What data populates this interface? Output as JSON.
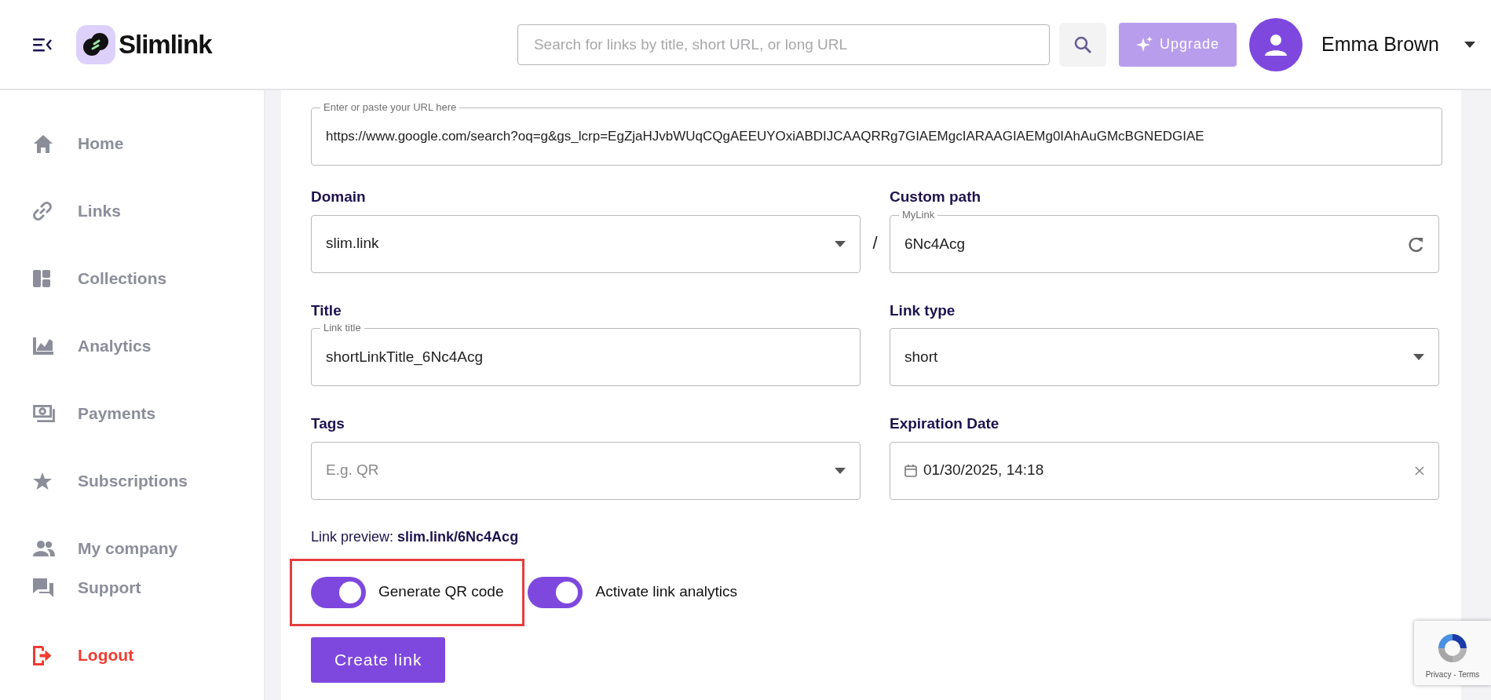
{
  "header": {
    "brand": "Slimlink",
    "search": {
      "placeholder": "Search for links by title, short URL, or long URL"
    },
    "upgrade_button": "Upgrade",
    "user": {
      "name": "Emma Brown"
    }
  },
  "sidebar": {
    "items": [
      {
        "label": "Home",
        "kind": "nav"
      },
      {
        "label": "Links",
        "kind": "nav"
      },
      {
        "label": "Collections",
        "kind": "nav"
      },
      {
        "label": "Analytics",
        "kind": "nav"
      },
      {
        "label": "Payments",
        "kind": "nav"
      },
      {
        "label": "Subscriptions",
        "kind": "nav"
      },
      {
        "label": "My company",
        "kind": "nav"
      }
    ],
    "bottom_items": [
      {
        "label": "Support",
        "kind": "nav"
      },
      {
        "label": "Logout",
        "kind": "logout"
      }
    ]
  },
  "form": {
    "url": {
      "legend": "Enter or paste your URL here",
      "value": "https://www.google.com/search?oq=g&gs_lcrp=EgZjaHJvbWUqCQgAEEUYOxiABDIJCAAQRRg7GIAEMgcIARAAGIAEMg0IAhAuGMcBGNEDGIAE"
    },
    "path_separator": "/",
    "rows": [
      [
        {
          "label": "Domain",
          "kind": "select",
          "value": "slim.link"
        },
        {
          "label": "Custom path",
          "kind": "text",
          "legend": "MyLink",
          "value": "6Nc4Acg"
        }
      ],
      [
        {
          "label": "Title",
          "kind": "text_plain",
          "legend": "Link title",
          "value": "shortLinkTitle_6Nc4Acg"
        },
        {
          "label": "Link type",
          "kind": "select",
          "value": "short"
        }
      ],
      [
        {
          "label": "Tags",
          "kind": "select",
          "placeholder": "E.g. QR"
        },
        {
          "label": "Expiration Date",
          "kind": "date",
          "value": "01/30/2025, 14:18"
        }
      ]
    ],
    "link_preview": "Link preview: **slim.link/6Nc4Acg**",
    "toggles": [
      {
        "label": "Generate QR code",
        "on": true,
        "highlighted": true
      },
      {
        "label": "Activate link analytics",
        "on": true,
        "highlighted": false
      }
    ],
    "submit_button": "Create link"
  },
  "recaptcha": {
    "terms": "Privacy - Terms"
  }
}
